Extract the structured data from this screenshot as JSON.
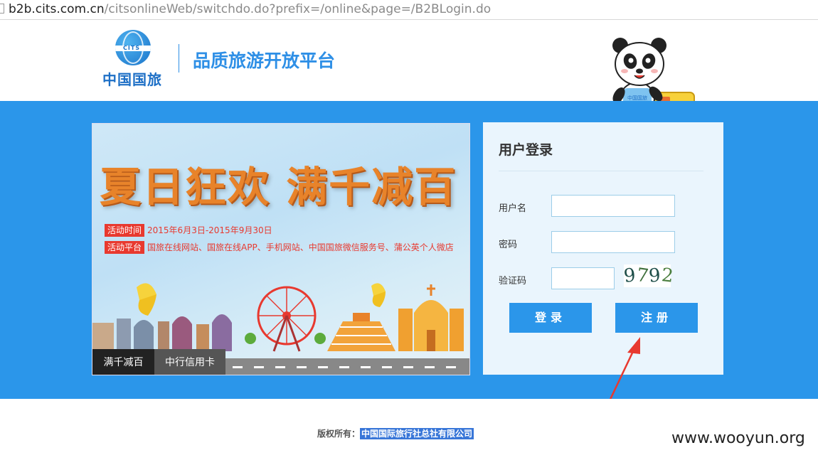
{
  "browser": {
    "url_host": "b2b.cits.com.cn",
    "url_path": "/citsonlineWeb/switchdo.do?prefix=/online&page=/B2BLogin.do"
  },
  "header": {
    "logo_badge": "CITS",
    "logo_text": "中国国旅",
    "slogan": "品质旅游开放平台",
    "mascot_shirt_text": "中国国旅"
  },
  "banner": {
    "headline": "夏日狂欢 满千减百",
    "promo_time_label": "活动时间",
    "promo_time_value": "2015年6月3日-2015年9月30日",
    "promo_platform_label": "活动平台",
    "promo_platform_value": "国旅在线网站、国旅在线APP、手机网站、中国国旅微信服务号、蒲公英个人微店",
    "tabs": [
      {
        "label": "满千减百",
        "active": true
      },
      {
        "label": "中行信用卡",
        "active": false
      }
    ]
  },
  "login": {
    "title": "用户登录",
    "username_label": "用户名",
    "username_value": "",
    "password_label": "密码",
    "password_value": "",
    "captcha_label": "验证码",
    "captcha_value": "",
    "captcha_digits": [
      "9",
      "7",
      "9",
      "2"
    ],
    "login_button": "登录",
    "register_button": "注册"
  },
  "footer": {
    "copyright_prefix": "版权所有：",
    "company": "中国国际旅行社总社有限公司"
  },
  "watermark": "www.wooyun.org",
  "colors": {
    "brand_blue": "#2b96ea",
    "logo_blue": "#1d6fc6",
    "promo_red": "#e8392f",
    "headline_orange": "#e8832a",
    "annotation_red": "#e8392f"
  }
}
